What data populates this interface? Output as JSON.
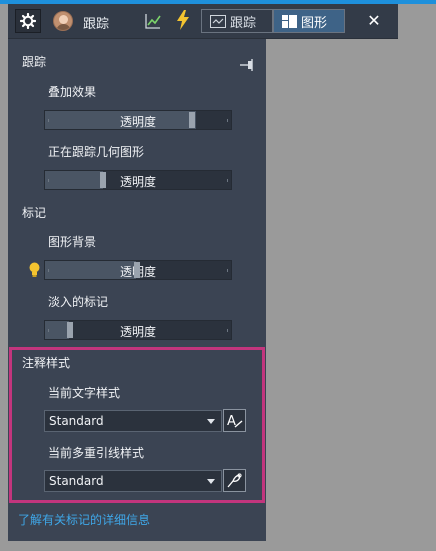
{
  "toolbar": {
    "user_label": "跟踪",
    "seg_track_label": "跟踪",
    "seg_graph_label": "图形",
    "close_label": "✕"
  },
  "panel": {
    "track": {
      "title": "跟踪",
      "overlay_label": "叠加效果",
      "overlay_slider": {
        "text": "透明度",
        "value": 0.81
      },
      "tracking_geometry_label": "正在跟踪几何图形",
      "geometry_slider": {
        "text": "透明度",
        "value": 0.31
      }
    },
    "markup": {
      "title": "标记",
      "background_label": "图形背景",
      "background_slider": {
        "text": "透明度",
        "value": 0.49
      },
      "faded_label": "淡入的标记",
      "faded_slider": {
        "text": "透明度",
        "value": 0.13
      }
    },
    "annotation": {
      "title": "注释样式",
      "text_style_label": "当前文字样式",
      "text_style_value": "Standard",
      "multileader_label": "当前多重引线样式",
      "multileader_value": "Standard"
    },
    "learn_more_link": "了解有关标记的详细信息"
  },
  "colors": {
    "accent_blue": "#1e90dc",
    "highlight_border": "#c2357d",
    "link": "#3fa7e8",
    "panel_bg": "#3b4453"
  },
  "icons": {
    "gear": "gear-icon",
    "avatar": "avatar",
    "chart": "chart-check-icon",
    "bolt": "lightning-icon",
    "pin": "pin-icon",
    "bulb": "lightbulb-icon",
    "text_style": "text-style-icon",
    "leader": "multileader-icon"
  }
}
